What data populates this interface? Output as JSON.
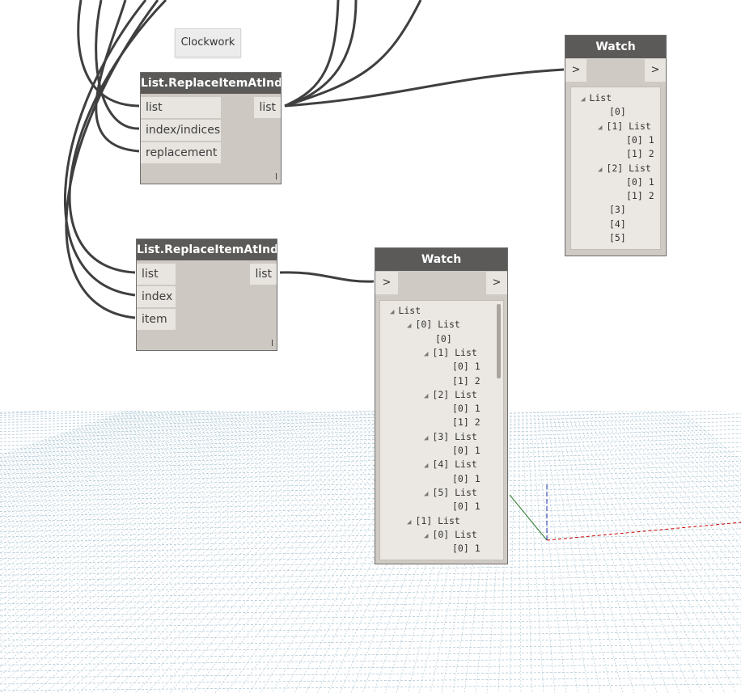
{
  "group": {
    "label": "Clockwork"
  },
  "node1": {
    "title": "List.ReplaceItemAtIndex",
    "inputs": [
      "list",
      "index/indices",
      "replacement"
    ],
    "output": "list",
    "lacing": "l"
  },
  "node2": {
    "title": "List.ReplaceItemAtIndex",
    "inputs": [
      "list",
      "index",
      "item"
    ],
    "output": "list",
    "lacing": "l"
  },
  "watch1": {
    "title": "Watch",
    "in_label": ">",
    "out_label": ">",
    "tree": [
      {
        "text": "List",
        "expander": true,
        "level": 0
      },
      {
        "text": "[0]",
        "expander": false,
        "level": 1
      },
      {
        "text": "[1] List",
        "expander": true,
        "level": 1
      },
      {
        "text": "[0] 1",
        "expander": false,
        "level": 2
      },
      {
        "text": "[1] 2",
        "expander": false,
        "level": 2
      },
      {
        "text": "[2] List",
        "expander": true,
        "level": 1
      },
      {
        "text": "[0] 1",
        "expander": false,
        "level": 2
      },
      {
        "text": "[1] 2",
        "expander": false,
        "level": 2
      },
      {
        "text": "[3]",
        "expander": false,
        "level": 1
      },
      {
        "text": "[4]",
        "expander": false,
        "level": 1
      },
      {
        "text": "[5]",
        "expander": false,
        "level": 1
      }
    ]
  },
  "watch2": {
    "title": "Watch",
    "in_label": ">",
    "out_label": ">",
    "tree": [
      {
        "text": "List",
        "expander": true,
        "level": 0
      },
      {
        "text": "[0] List",
        "expander": true,
        "level": 1
      },
      {
        "text": "[0]",
        "expander": false,
        "level": 2
      },
      {
        "text": "[1] List",
        "expander": true,
        "level": 2
      },
      {
        "text": "[0] 1",
        "expander": false,
        "level": 3
      },
      {
        "text": "[1] 2",
        "expander": false,
        "level": 3
      },
      {
        "text": "[2] List",
        "expander": true,
        "level": 2
      },
      {
        "text": "[0] 1",
        "expander": false,
        "level": 3
      },
      {
        "text": "[1] 2",
        "expander": false,
        "level": 3
      },
      {
        "text": "[3] List",
        "expander": true,
        "level": 2
      },
      {
        "text": "[0] 1",
        "expander": false,
        "level": 3
      },
      {
        "text": "[4] List",
        "expander": true,
        "level": 2
      },
      {
        "text": "[0] 1",
        "expander": false,
        "level": 3
      },
      {
        "text": "[5] List",
        "expander": true,
        "level": 2
      },
      {
        "text": "[0] 1",
        "expander": false,
        "level": 3
      },
      {
        "text": "[1] List",
        "expander": true,
        "level": 1
      },
      {
        "text": "[0] List",
        "expander": true,
        "level": 2
      },
      {
        "text": "[0] 1",
        "expander": false,
        "level": 3
      }
    ]
  },
  "colors": {
    "node_header": "#5b5a59",
    "node_body": "#cdc8c2",
    "port_bg": "#e8e5e0",
    "wire": "#3f3f3f",
    "grid": "#a9c4d2",
    "axis_x": "#cc0000",
    "axis_y": "#2a7a2a",
    "axis_z": "#2233aa"
  },
  "icons": [
    "expander-triangle-icon",
    "output-port-icon",
    "input-port-icon"
  ]
}
